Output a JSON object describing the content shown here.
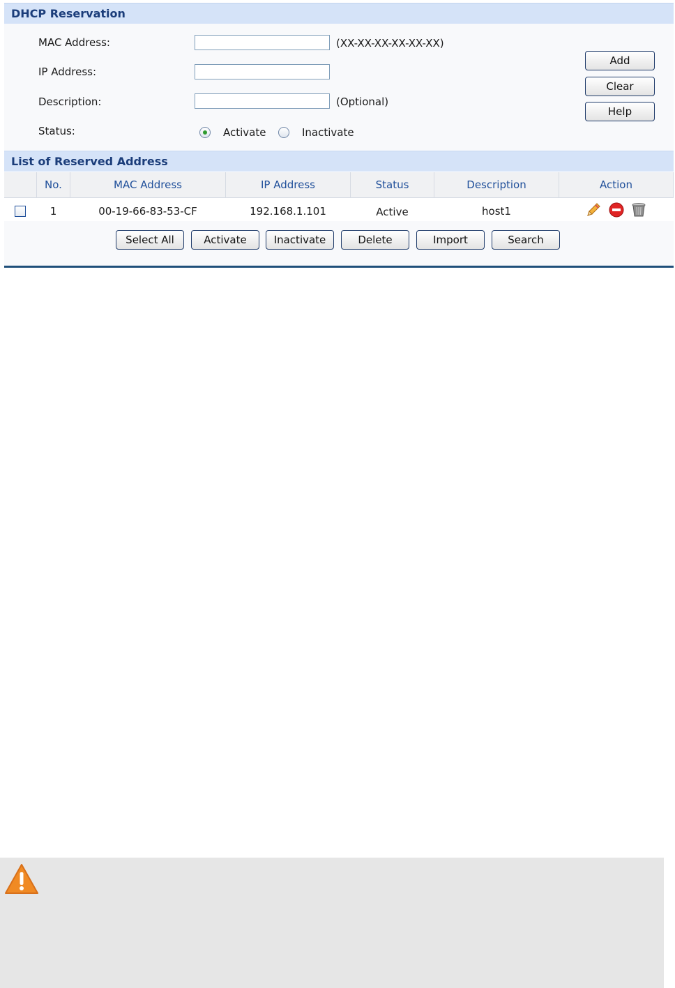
{
  "reservation": {
    "title": "DHCP Reservation",
    "mac_label": "MAC Address:",
    "mac_value": "",
    "mac_hint": "(XX-XX-XX-XX-XX-XX)",
    "ip_label": "IP Address:",
    "ip_value": "",
    "desc_label": "Description:",
    "desc_value": "",
    "desc_hint": "(Optional)",
    "status_label": "Status:",
    "status_options": [
      "Activate",
      "Inactivate"
    ],
    "status_selected": "Activate",
    "buttons": {
      "add": "Add",
      "clear": "Clear",
      "help": "Help"
    }
  },
  "list": {
    "title": "List of Reserved Address",
    "columns": [
      "No.",
      "MAC Address",
      "IP Address",
      "Status",
      "Description",
      "Action"
    ],
    "rows": [
      {
        "no": "1",
        "mac": "00-19-66-83-53-CF",
        "ip": "192.168.1.101",
        "status": "Active",
        "description": "host1",
        "actions": [
          "edit-icon",
          "disable-icon",
          "delete-icon"
        ]
      }
    ],
    "buttons": {
      "select_all": "Select All",
      "activate": "Activate",
      "inactivate": "Inactivate",
      "delete": "Delete",
      "import": "Import",
      "search": "Search"
    }
  },
  "note": {
    "icon": "warning-icon"
  },
  "colors": {
    "header_bg": "#d5e3f8",
    "header_text": "#1b3d7a",
    "column_text": "#1f4f9a",
    "divider": "#1f4f7a",
    "note_bg": "#e6e6e6",
    "warning": "#f08a24"
  }
}
